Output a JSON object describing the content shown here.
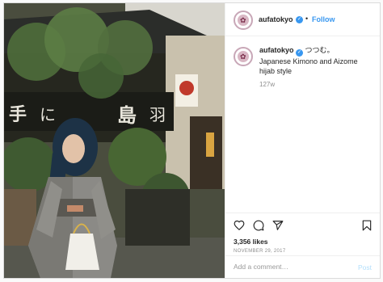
{
  "post": {
    "username": "aufatokyo",
    "verified_symbol": "✓",
    "separator": "•",
    "follow_label": "Follow",
    "caption_extra": "つつむ。",
    "caption_text": "Japanese Kimono and Aizome hijab style",
    "caption_time": "127w",
    "likes": "3,356 likes",
    "date": "NOVEMBER 29, 2017",
    "comment_placeholder": "Add a comment…",
    "post_label": "Post",
    "avatar_glyph": "✿"
  },
  "photo": {
    "sign_characters": [
      "手",
      "に",
      "島",
      "羽"
    ],
    "lantern_text": "⚑"
  },
  "icons": {
    "like": "heart-icon",
    "comment": "comment-icon",
    "share": "share-icon",
    "save": "bookmark-icon",
    "verified": "verified-badge-icon"
  },
  "colors": {
    "accent": "#3897f0",
    "post_disabled": "#b2dffc",
    "muted": "#8e8e8e",
    "text": "#262626"
  }
}
